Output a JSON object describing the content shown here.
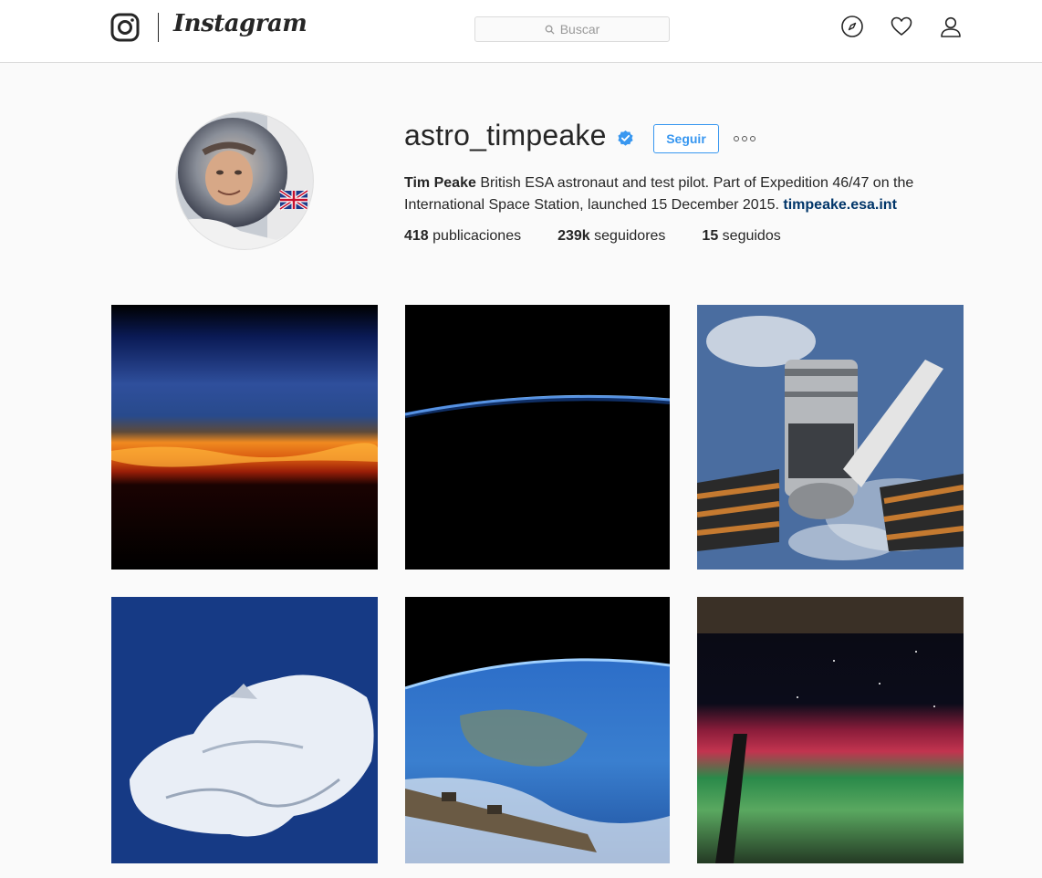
{
  "app": {
    "wordmark": "Instagram"
  },
  "search": {
    "placeholder": "Buscar"
  },
  "profile": {
    "username": "astro_timpeake",
    "verified": true,
    "follow_label": "Seguir",
    "full_name": "Tim Peake",
    "bio": " British ESA astronaut and test pilot. Part of Expedition 46/47 on the International Space Station, launched 15 December 2015. ",
    "website": "timpeake.esa.int",
    "stats": {
      "posts_count": "418",
      "posts_label": " publicaciones",
      "followers_count": "239k",
      "followers_label": " seguidores",
      "following_count": "15",
      "following_label": " seguidos"
    }
  },
  "colors": {
    "accent": "#3897f0",
    "link": "#003569",
    "verified": "#3897f0"
  },
  "posts": [
    {
      "subject": "orbital-sunset-horizon"
    },
    {
      "subject": "earth-limb-at-night"
    },
    {
      "subject": "cygnus-cargo-spacecraft-robotic-arm"
    },
    {
      "subject": "snow-covered-island"
    },
    {
      "subject": "earth-with-station-arm"
    },
    {
      "subject": "aurora-and-stars"
    }
  ]
}
